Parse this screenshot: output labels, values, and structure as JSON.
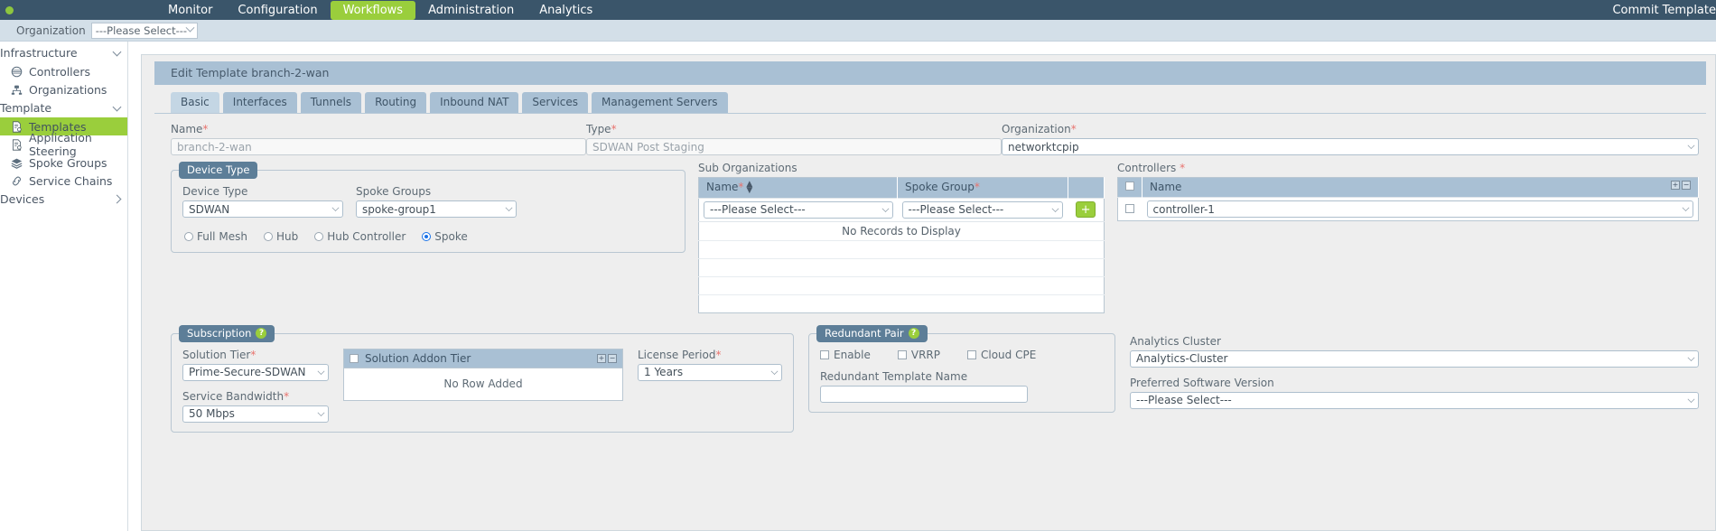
{
  "topnav": {
    "brand": "",
    "items": [
      {
        "label": "Monitor",
        "active": false
      },
      {
        "label": "Configuration",
        "active": false
      },
      {
        "label": "Workflows",
        "active": true
      },
      {
        "label": "Administration",
        "active": false
      },
      {
        "label": "Analytics",
        "active": false
      }
    ],
    "right_label": "Commit Template"
  },
  "orgbar": {
    "label": "Organization",
    "value": "---Please Select---"
  },
  "sidebar": {
    "groups": [
      {
        "label": "Infrastructure",
        "expanded": true
      },
      {
        "label": "Template",
        "expanded": true
      },
      {
        "label": "Devices",
        "expanded": false
      }
    ],
    "infrastructure_items": [
      {
        "label": "Controllers",
        "icon": "controller-icon",
        "active": false
      },
      {
        "label": "Organizations",
        "icon": "organization-icon",
        "active": false
      }
    ],
    "template_items": [
      {
        "label": "Templates",
        "icon": "template-icon",
        "active": true
      },
      {
        "label": "Application Steering",
        "icon": "template-icon",
        "active": false
      },
      {
        "label": "Spoke Groups",
        "icon": "spoke-groups-icon",
        "active": false
      },
      {
        "label": "Service Chains",
        "icon": "service-chain-icon",
        "active": false
      }
    ]
  },
  "panel": {
    "title": "Edit Template branch-2-wan",
    "tabs": [
      {
        "label": "Basic",
        "active": true
      },
      {
        "label": "Interfaces",
        "active": false
      },
      {
        "label": "Tunnels",
        "active": false
      },
      {
        "label": "Routing",
        "active": false
      },
      {
        "label": "Inbound NAT",
        "active": false
      },
      {
        "label": "Services",
        "active": false
      },
      {
        "label": "Management Servers",
        "active": false
      }
    ]
  },
  "basic": {
    "name_label": "Name",
    "name_value": "branch-2-wan",
    "type_label": "Type",
    "type_value": "SDWAN Post Staging",
    "org_label": "Organization",
    "org_value": "networktcpip"
  },
  "device_type": {
    "legend": "Device Type",
    "device_type_label": "Device Type",
    "device_type_value": "SDWAN",
    "spoke_groups_label": "Spoke Groups",
    "spoke_groups_value": "spoke-group1",
    "radios": [
      {
        "label": "Full Mesh",
        "selected": false
      },
      {
        "label": "Hub",
        "selected": false
      },
      {
        "label": "Hub Controller",
        "selected": false
      },
      {
        "label": "Spoke",
        "selected": true
      }
    ]
  },
  "sub_organizations": {
    "label": "Sub Organizations",
    "columns": [
      "Name",
      "Spoke Group",
      ""
    ],
    "row": {
      "name_value": "---Please Select---",
      "spoke_group_value": "---Please Select---",
      "add_label": "+"
    },
    "empty_text": "No Records to Display"
  },
  "controllers": {
    "label": "Controllers",
    "column_name": "Name",
    "row_value": "controller-1"
  },
  "subscription": {
    "legend": "Subscription",
    "help": "?",
    "solution_tier_label": "Solution Tier",
    "solution_tier_value": "Prime-Secure-SDWAN",
    "service_bandwidth_label": "Service Bandwidth",
    "service_bandwidth_value": "50 Mbps",
    "addon_header": "Solution Addon Tier",
    "addon_empty": "No Row Added",
    "license_period_label": "License Period",
    "license_period_value": "1 Years"
  },
  "redundant_pair": {
    "legend": "Redundant Pair",
    "help": "?",
    "checkboxes": [
      {
        "label": "Enable",
        "checked": false
      },
      {
        "label": "VRRP",
        "checked": false
      },
      {
        "label": "Cloud CPE",
        "checked": false
      }
    ],
    "template_name_label": "Redundant Template Name",
    "template_name_value": ""
  },
  "right_panel": {
    "analytics_cluster_label": "Analytics Cluster",
    "analytics_cluster_value": "Analytics-Cluster",
    "preferred_version_label": "Preferred Software Version",
    "preferred_version_value": "---Please Select---"
  },
  "colors": {
    "nav_bg": "#3a556a",
    "accent_green": "#9ace3c",
    "panel_header": "#a9c0d4",
    "orgbar_bg": "#d3dfe8",
    "required_red": "#e8736e"
  }
}
